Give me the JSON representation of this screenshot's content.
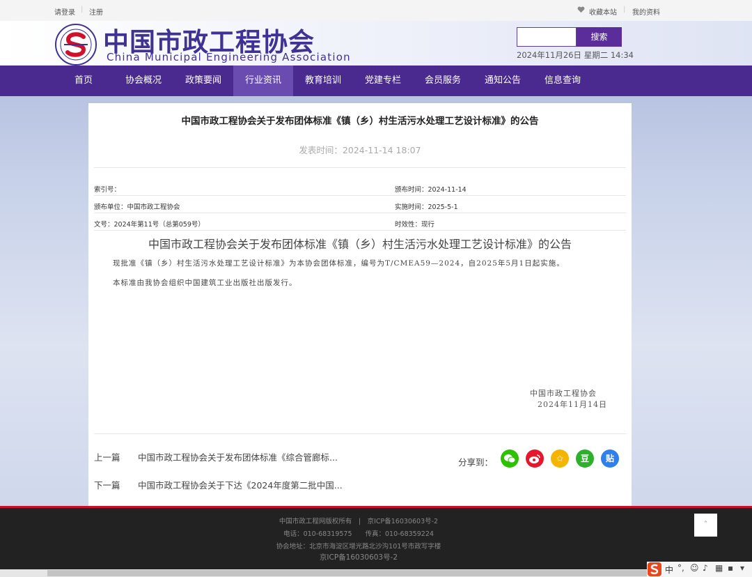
{
  "topbar": {
    "login": "请登录",
    "register": "注册",
    "favorite": "收藏本站",
    "profile": "我的资料"
  },
  "header": {
    "title_cn": "中国市政工程协会",
    "title_en": "China Municipal Engineering Association",
    "search_button": "搜索",
    "search_placeholder": "",
    "datetime": "2024年11月26日 星期二 14:34"
  },
  "nav": {
    "items": [
      {
        "label": "首页"
      },
      {
        "label": "协会概况"
      },
      {
        "label": "政策要闻"
      },
      {
        "label": "行业资讯"
      },
      {
        "label": "教育培训"
      },
      {
        "label": "党建专栏"
      },
      {
        "label": "会员服务"
      },
      {
        "label": "通知公告"
      },
      {
        "label": "信息查询"
      }
    ],
    "active": "行业资讯"
  },
  "article": {
    "title": "中国市政工程协会关于发布团体标准《镇（乡）村生活污水处理工艺设计标准》的公告",
    "pubtime": "发表时间：2024-11-14 18:07",
    "meta": {
      "index_label": "索引号：",
      "index_value": "",
      "issue_date": "颁布时间：2024-11-14",
      "issuer": "颁布单位：中国市政工程协会",
      "effective_date": "实施时间：2025-5-1",
      "doc_no": "文号：2024年第11号（总第059号）",
      "validity": "时效性：现行"
    },
    "body_title": "中国市政工程协会关于发布团体标准《镇（乡）村生活污水处理工艺设计标准》的公告",
    "para1": "现批准《镇（乡）村生活污水处理工艺设计标准》为本协会团体标准，编号为T/CMEA59—2024，自2025年5月1日起实施。",
    "para2": "本标准由我协会组织中国建筑工业出版社出版发行。",
    "sign_org": "中国市政工程协会",
    "sign_date": "2024年11月14日"
  },
  "pager": {
    "prev_label": "上一篇",
    "prev_title": "中国市政工程协会关于发布团体标准《综合管廊标...",
    "next_label": "下一篇",
    "next_title": "中国市政工程协会关于下达《2024年度第二批中国..."
  },
  "share": {
    "label": "分享到：",
    "icons": [
      {
        "name": "wechat-icon",
        "glyph": "",
        "color": "#2dc100"
      },
      {
        "name": "weibo-icon",
        "glyph": "",
        "color": "#e6162d"
      },
      {
        "name": "qzone-icon",
        "glyph": "✩",
        "color": "#f4b400"
      },
      {
        "name": "douban-icon",
        "glyph": "豆",
        "color": "#2db12d"
      },
      {
        "name": "tieba-icon",
        "glyph": "贴",
        "color": "#2f80ed"
      }
    ]
  },
  "footer": {
    "line1": "中国市政工程网版权所有　|　京ICP备16030603号-2",
    "line2": "电话：010-68319575　　传真：010-68359224",
    "line3": "协会地址：北京市海淀区增光路北沙沟101号市政写字楼",
    "line4": "京ICP备16030603号-2",
    "totop": "ˆ"
  },
  "ime": {
    "label": "中"
  }
}
